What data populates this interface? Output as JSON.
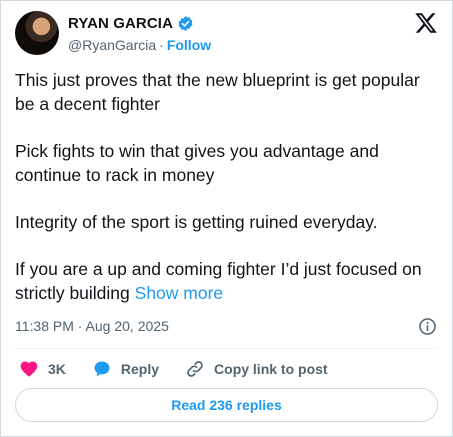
{
  "author": {
    "display_name": "RYAN GARCIA",
    "handle": "@RyanGarcia",
    "separator": "·",
    "follow_label": "Follow"
  },
  "tweet": {
    "paragraphs": [
      "This just proves that the new blueprint is get popular be a decent fighter",
      "Pick fights to win that gives you advantage and continue to rack in money",
      "Integrity of the sport is getting ruined everyday."
    ],
    "last_paragraph": "If you are a up and coming fighter I’d just focused on strictly building",
    "show_more_label": "Show more",
    "timestamp": "11:38 PM · Aug 20, 2025"
  },
  "actions": {
    "like_count": "3K",
    "reply_label": "Reply",
    "copy_link_label": "Copy link to post"
  },
  "read_replies_label": "Read 236 replies",
  "colors": {
    "accent": "#1d9bf0",
    "like": "#f91880",
    "secondary_text": "#536471",
    "border": "#cfd9de"
  },
  "icons": [
    "verified-badge-icon",
    "x-logo-icon",
    "info-icon",
    "heart-icon",
    "reply-bubble-icon",
    "link-icon"
  ]
}
